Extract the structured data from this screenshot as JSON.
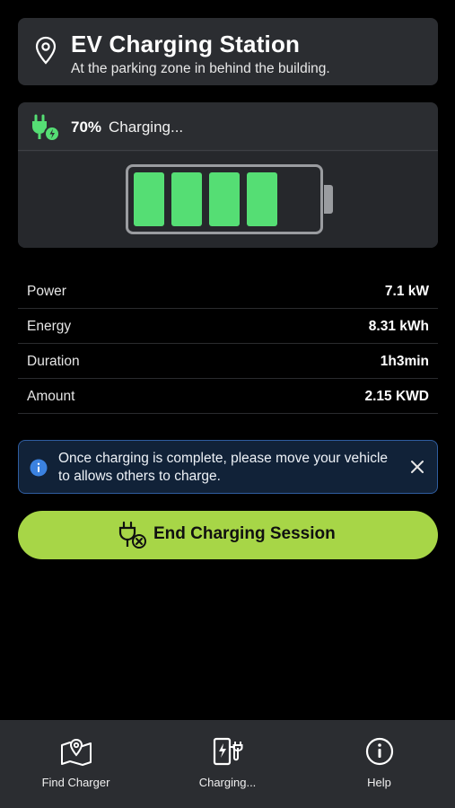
{
  "station": {
    "title": "EV Charging Station",
    "subtitle": "At the parking zone in behind the building.",
    "icon": "location-pin-icon"
  },
  "charging": {
    "percent": "70%",
    "status": "Charging...",
    "icon": "plug-charging-icon",
    "battery_level": 0.7,
    "filled_cells": 4,
    "cell_color": "#55de74"
  },
  "stats": [
    {
      "label": "Power",
      "value": "7.1 kW"
    },
    {
      "label": "Energy",
      "value": "8.31 kWh"
    },
    {
      "label": "Duration",
      "value": "1h3min"
    },
    {
      "label": "Amount",
      "value": "2.15 KWD"
    }
  ],
  "notice": {
    "message": "Once charging is complete, please move your vehicle to allows others to charge.",
    "icon": "info-icon",
    "close_icon": "close-icon"
  },
  "end_button": {
    "label": "End Charging Session",
    "icon": "unplug-icon",
    "color": "#a7d647"
  },
  "tabs": [
    {
      "label": "Find Charger",
      "icon": "map-pin-icon"
    },
    {
      "label": "Charging...",
      "icon": "charging-station-icon"
    },
    {
      "label": "Help",
      "icon": "info-circle-icon"
    }
  ]
}
